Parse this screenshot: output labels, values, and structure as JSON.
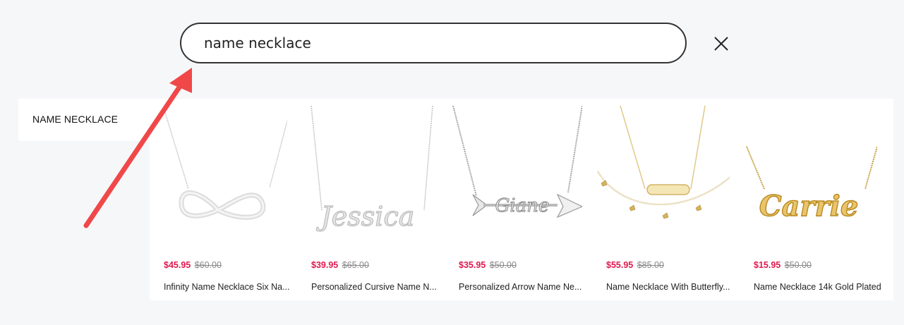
{
  "search": {
    "value": "name necklace"
  },
  "close_icon": "close-icon",
  "suggestions": [
    {
      "label": "NAME NECKLACE"
    }
  ],
  "products": [
    {
      "sale_price": "$45.95",
      "original_price": "$60.00",
      "name": "Infinity Name Necklace Six Na...",
      "metal": "silver"
    },
    {
      "sale_price": "$39.95",
      "original_price": "$65.00",
      "name": "Personalized Cursive Name N...",
      "metal": "silver"
    },
    {
      "sale_price": "$35.95",
      "original_price": "$50.00",
      "name": "Personalized Arrow Name Ne...",
      "metal": "silver"
    },
    {
      "sale_price": "$55.95",
      "original_price": "$85.00",
      "name": "Name Necklace With Butterfly...",
      "metal": "gold"
    },
    {
      "sale_price": "$15.95",
      "original_price": "$50.00",
      "name": "Name Necklace 14k Gold Plated",
      "metal": "gold"
    }
  ],
  "colors": {
    "sale_price": "#e0184f",
    "arrow": "#f04848"
  }
}
